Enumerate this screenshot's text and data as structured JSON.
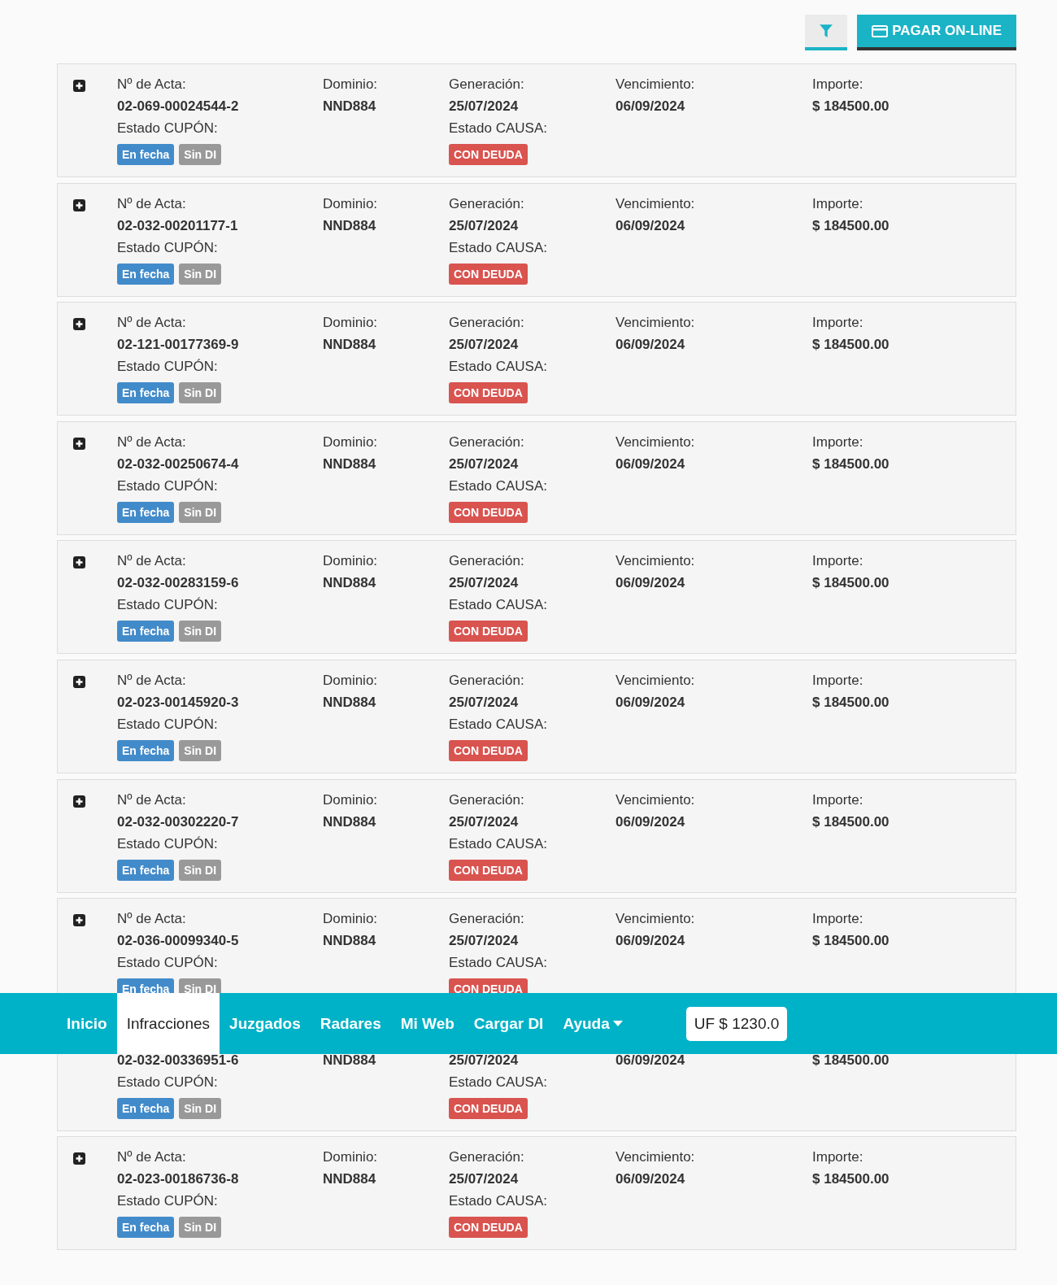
{
  "toolbar": {
    "filter_button": {
      "selected": true
    },
    "pay_button": {
      "label": "PAGAR ON-LINE"
    }
  },
  "rows": [
    {
      "acta_label": "Nº de Acta:",
      "acta": "02-069-00024544-2",
      "dominio_label": "Dominio:",
      "dominio": "NND884",
      "generacion_label": "Generación:",
      "generacion": "25/07/2024",
      "vencimiento_label": "Vencimiento:",
      "vencimiento": "06/09/2024",
      "importe_label": "Importe:",
      "importe": "$ 184500.00",
      "cupon_label": "Estado CUPÓN:",
      "cupon_badges": [
        {
          "label": "En fecha",
          "color": "#428bca"
        },
        {
          "label": "Sin DI",
          "color": "#999999"
        }
      ],
      "causa_label": "Estado CAUSA:",
      "causa_badge": {
        "label": "CON DEUDA",
        "color": "#d9534f"
      }
    },
    {
      "acta_label": "Nº de Acta:",
      "acta": "02-032-00201177-1",
      "dominio_label": "Dominio:",
      "dominio": "NND884",
      "generacion_label": "Generación:",
      "generacion": "25/07/2024",
      "vencimiento_label": "Vencimiento:",
      "vencimiento": "06/09/2024",
      "importe_label": "Importe:",
      "importe": "$ 184500.00",
      "cupon_label": "Estado CUPÓN:",
      "cupon_badges": [
        {
          "label": "En fecha",
          "color": "#428bca"
        },
        {
          "label": "Sin DI",
          "color": "#999999"
        }
      ],
      "causa_label": "Estado CAUSA:",
      "causa_badge": {
        "label": "CON DEUDA",
        "color": "#d9534f"
      }
    },
    {
      "acta_label": "Nº de Acta:",
      "acta": "02-121-00177369-9",
      "dominio_label": "Dominio:",
      "dominio": "NND884",
      "generacion_label": "Generación:",
      "generacion": "25/07/2024",
      "vencimiento_label": "Vencimiento:",
      "vencimiento": "06/09/2024",
      "importe_label": "Importe:",
      "importe": "$ 184500.00",
      "cupon_label": "Estado CUPÓN:",
      "cupon_badges": [
        {
          "label": "En fecha",
          "color": "#428bca"
        },
        {
          "label": "Sin DI",
          "color": "#999999"
        }
      ],
      "causa_label": "Estado CAUSA:",
      "causa_badge": {
        "label": "CON DEUDA",
        "color": "#d9534f"
      }
    },
    {
      "acta_label": "Nº de Acta:",
      "acta": "02-032-00250674-4",
      "dominio_label": "Dominio:",
      "dominio": "NND884",
      "generacion_label": "Generación:",
      "generacion": "25/07/2024",
      "vencimiento_label": "Vencimiento:",
      "vencimiento": "06/09/2024",
      "importe_label": "Importe:",
      "importe": "$ 184500.00",
      "cupon_label": "Estado CUPÓN:",
      "cupon_badges": [
        {
          "label": "En fecha",
          "color": "#428bca"
        },
        {
          "label": "Sin DI",
          "color": "#999999"
        }
      ],
      "causa_label": "Estado CAUSA:",
      "causa_badge": {
        "label": "CON DEUDA",
        "color": "#d9534f"
      }
    },
    {
      "acta_label": "Nº de Acta:",
      "acta": "02-032-00283159-6",
      "dominio_label": "Dominio:",
      "dominio": "NND884",
      "generacion_label": "Generación:",
      "generacion": "25/07/2024",
      "vencimiento_label": "Vencimiento:",
      "vencimiento": "06/09/2024",
      "importe_label": "Importe:",
      "importe": "$ 184500.00",
      "cupon_label": "Estado CUPÓN:",
      "cupon_badges": [
        {
          "label": "En fecha",
          "color": "#428bca"
        },
        {
          "label": "Sin DI",
          "color": "#999999"
        }
      ],
      "causa_label": "Estado CAUSA:",
      "causa_badge": {
        "label": "CON DEUDA",
        "color": "#d9534f"
      }
    },
    {
      "acta_label": "Nº de Acta:",
      "acta": "02-023-00145920-3",
      "dominio_label": "Dominio:",
      "dominio": "NND884",
      "generacion_label": "Generación:",
      "generacion": "25/07/2024",
      "vencimiento_label": "Vencimiento:",
      "vencimiento": "06/09/2024",
      "importe_label": "Importe:",
      "importe": "$ 184500.00",
      "cupon_label": "Estado CUPÓN:",
      "cupon_badges": [
        {
          "label": "En fecha",
          "color": "#428bca"
        },
        {
          "label": "Sin DI",
          "color": "#999999"
        }
      ],
      "causa_label": "Estado CAUSA:",
      "causa_badge": {
        "label": "CON DEUDA",
        "color": "#d9534f"
      }
    },
    {
      "acta_label": "Nº de Acta:",
      "acta": "02-032-00302220-7",
      "dominio_label": "Dominio:",
      "dominio": "NND884",
      "generacion_label": "Generación:",
      "generacion": "25/07/2024",
      "vencimiento_label": "Vencimiento:",
      "vencimiento": "06/09/2024",
      "importe_label": "Importe:",
      "importe": "$ 184500.00",
      "cupon_label": "Estado CUPÓN:",
      "cupon_badges": [
        {
          "label": "En fecha",
          "color": "#428bca"
        },
        {
          "label": "Sin DI",
          "color": "#999999"
        }
      ],
      "causa_label": "Estado CAUSA:",
      "causa_badge": {
        "label": "CON DEUDA",
        "color": "#d9534f"
      }
    },
    {
      "acta_label": "Nº de Acta:",
      "acta": "02-036-00099340-5",
      "dominio_label": "Dominio:",
      "dominio": "NND884",
      "generacion_label": "Generación:",
      "generacion": "25/07/2024",
      "vencimiento_label": "Vencimiento:",
      "vencimiento": "06/09/2024",
      "importe_label": "Importe:",
      "importe": "$ 184500.00",
      "cupon_label": "Estado CUPÓN:",
      "cupon_badges": [
        {
          "label": "En fecha",
          "color": "#428bca"
        },
        {
          "label": "Sin DI",
          "color": "#999999"
        }
      ],
      "causa_label": "Estado CAUSA:",
      "causa_badge": {
        "label": "CON DEUDA",
        "color": "#d9534f"
      }
    },
    {
      "acta": "02-032-00336951-6",
      "dominio": "NND884",
      "generacion": "25/07/2024",
      "vencimiento": "06/09/2024",
      "importe": "$ 184500.00",
      "cupon_label": "Estado CUPÓN:",
      "cupon_badges": [
        {
          "label": "En fecha",
          "color": "#428bca"
        },
        {
          "label": "Sin DI",
          "color": "#999999"
        }
      ],
      "causa_label": "Estado CAUSA:",
      "causa_badge": {
        "label": "CON DEUDA",
        "color": "#d9534f"
      }
    },
    {
      "acta_label": "Nº de Acta:",
      "acta": "02-023-00186736-8",
      "dominio_label": "Dominio:",
      "dominio": "NND884",
      "generacion_label": "Generación:",
      "generacion": "25/07/2024",
      "vencimiento_label": "Vencimiento:",
      "vencimiento": "06/09/2024",
      "importe_label": "Importe:",
      "importe": "$ 184500.00",
      "cupon_label": "Estado CUPÓN:",
      "cupon_badges": [
        {
          "label": "En fecha",
          "color": "#428bca"
        },
        {
          "label": "Sin DI",
          "color": "#999999"
        }
      ],
      "causa_label": "Estado CAUSA:",
      "causa_badge": {
        "label": "CON DEUDA",
        "color": "#d9534f"
      }
    }
  ],
  "navbar": {
    "items": [
      {
        "label": "Inicio",
        "selected": false,
        "dropdown": false
      },
      {
        "label": "Infracciones",
        "selected": true,
        "dropdown": false
      },
      {
        "label": "Juzgados",
        "selected": false,
        "dropdown": false
      },
      {
        "label": "Radares",
        "selected": false,
        "dropdown": false
      },
      {
        "label": "Mi Web",
        "selected": false,
        "dropdown": false
      },
      {
        "label": "Cargar DI",
        "selected": false,
        "dropdown": false
      },
      {
        "label": "Ayuda",
        "selected": false,
        "dropdown": true
      }
    ],
    "uf_badge": "UF $ 1230.0"
  }
}
